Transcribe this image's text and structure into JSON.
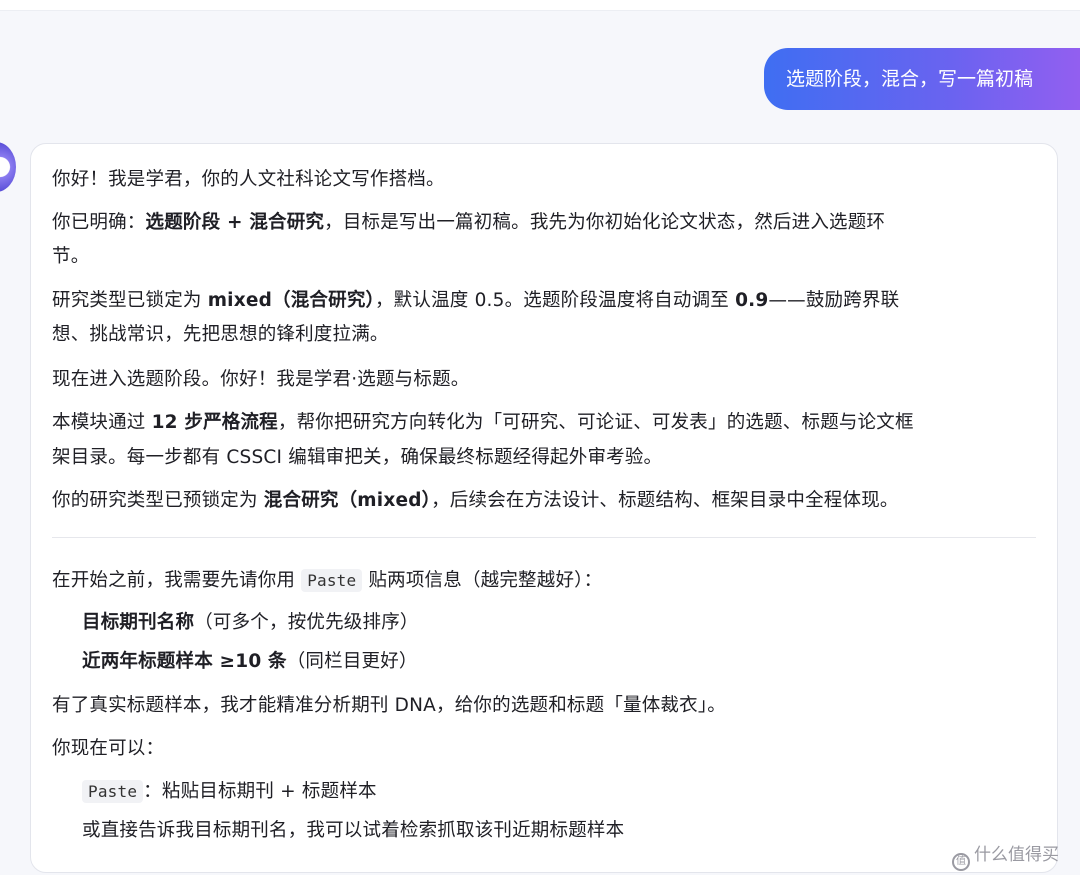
{
  "user_message": "选题阶段，混合，写一篇初稿",
  "reply": {
    "p1": "你好！我是学君，你的人文社科论文写作搭档。",
    "p2_pre": "你已明确：",
    "p2_b1": "选题阶段",
    "p2_plus": " + ",
    "p2_b2": "混合研究",
    "p2_post": "，目标是写出一篇初稿。我先为你初始化论文状态，然后进入选题环",
    "p2_cont": "节。",
    "p3_pre": "研究类型已锁定为 ",
    "p3_b1": "mixed（混合研究）",
    "p3_mid": "，默认温度 0.5。选题阶段温度将自动调至 ",
    "p3_b2": "0.9",
    "p3_post": "——鼓励跨界联",
    "p3_cont": "想、挑战常识，先把思想的锋利度拉满。",
    "p4": "现在进入选题阶段。你好！我是学君·选题与标题。",
    "p5_pre": "本模块通过 ",
    "p5_b": "12 步严格流程",
    "p5_post": "，帮你把研究方向转化为「可研究、可论证、可发表」的选题、标题与论文框",
    "p5_cont": "架目录。每一步都有 CSSCI 编辑审把关，确保最终标题经得起外审考验。",
    "p6_pre": "你的研究类型已预锁定为 ",
    "p6_b": "混合研究（mixed）",
    "p6_post": "，后续会在方法设计、标题结构、框架目录中全程体现。",
    "p7_pre": "在开始之前，我需要先请你用 ",
    "p7_code": "Paste",
    "p7_post": " 贴两项信息（越完整越好）：",
    "item1_b": "目标期刊名称",
    "item1_post": "（可多个，按优先级排序）",
    "item2_b": "近两年标题样本 ≥10 条",
    "item2_post": "（同栏目更好）",
    "p8": "有了真实标题样本，我才能精准分析期刊 DNA，给你的选题和标题「量体裁衣」。",
    "p9": "你现在可以：",
    "opt1_code": "Paste",
    "opt1_post": "：粘贴目标期刊 + 标题样本",
    "opt2": "或直接告诉我目标期刊名，我可以试着检索抓取该刊近期标题样本"
  },
  "watermark": "什么值得买",
  "watermark_icon": "zhi-icon",
  "colors": {
    "bubble_start": "#3f6ef2",
    "bubble_end": "#9a5ef0",
    "card_border": "#e3e5ec"
  }
}
